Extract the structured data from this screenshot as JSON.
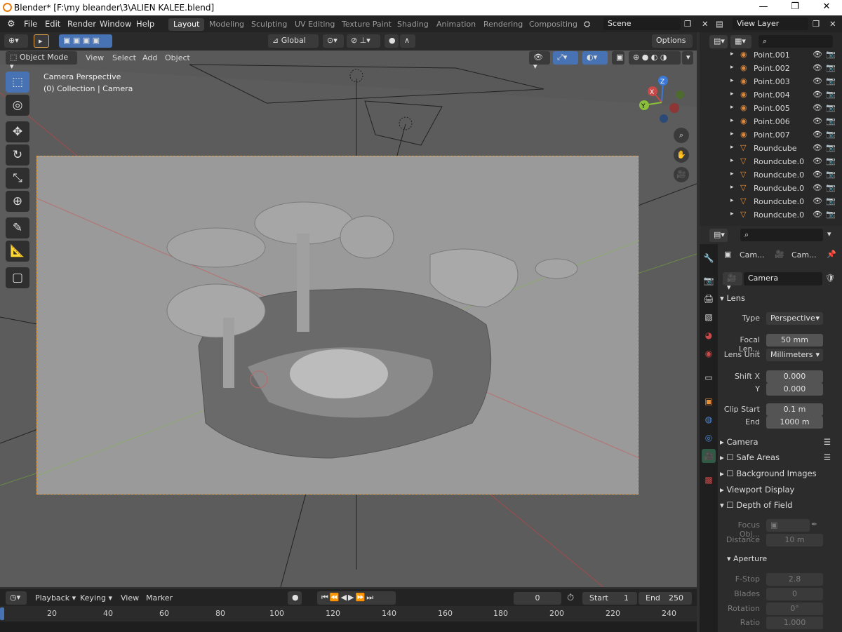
{
  "titlebar": {
    "title": "Blender* [F:\\my bleander\\3\\ALIEN KALEE.blend]",
    "min": "—",
    "max": "❐",
    "close": "✕"
  },
  "topbar": {
    "menus": [
      "File",
      "Edit",
      "Render",
      "Window",
      "Help"
    ],
    "workspaces": [
      "Layout",
      "Modeling",
      "Sculpting",
      "UV Editing",
      "Texture Paint",
      "Shading",
      "Animation",
      "Rendering",
      "Compositing"
    ],
    "active_workspace": "Layout",
    "scene": "Scene",
    "view_layer": "View Layer"
  },
  "viewport_header": {
    "transform_orientation": "Global",
    "options": "Options",
    "mode": "Object Mode",
    "menus": [
      "View",
      "Select",
      "Add",
      "Object"
    ]
  },
  "viewport": {
    "camera_label": "Camera Perspective",
    "collection_label": "(0) Collection | Camera",
    "gizmo": {
      "x": "X",
      "y": "Y",
      "z": "Z"
    }
  },
  "outliner": {
    "items": [
      {
        "name": "Point.001",
        "type": "light"
      },
      {
        "name": "Point.002",
        "type": "light"
      },
      {
        "name": "Point.003",
        "type": "light"
      },
      {
        "name": "Point.004",
        "type": "light"
      },
      {
        "name": "Point.005",
        "type": "light"
      },
      {
        "name": "Point.006",
        "type": "light"
      },
      {
        "name": "Point.007",
        "type": "light"
      },
      {
        "name": "Roundcube",
        "type": "mesh"
      },
      {
        "name": "Roundcube.0",
        "type": "mesh"
      },
      {
        "name": "Roundcube.0",
        "type": "mesh"
      },
      {
        "name": "Roundcube.0",
        "type": "mesh"
      },
      {
        "name": "Roundcube.0",
        "type": "mesh"
      },
      {
        "name": "Roundcube.0",
        "type": "mesh"
      }
    ]
  },
  "properties": {
    "breadcrumb_a": "Cam...",
    "breadcrumb_b": "Cam...",
    "datablock": "Camera",
    "lens_header": "Lens",
    "type_label": "Type",
    "type_value": "Perspective",
    "focal_label": "Focal Len...",
    "focal_value": "50 mm",
    "lens_unit_label": "Lens Unit",
    "lens_unit_value": "Millimeters",
    "shift_x_label": "Shift X",
    "shift_x_value": "0.000",
    "shift_y_label": "Y",
    "shift_y_value": "0.000",
    "clip_start_label": "Clip Start",
    "clip_start_value": "0.1 m",
    "clip_end_label": "End",
    "clip_end_value": "1000 m",
    "sections": [
      "Camera",
      "Safe Areas",
      "Background Images",
      "Viewport Display",
      "Depth of Field"
    ],
    "focus_label": "Focus Obj...",
    "distance_label": "Distance",
    "distance_value": "10 m",
    "aperture_header": "Aperture",
    "fstop_label": "F-Stop",
    "fstop_value": "2.8",
    "blades_label": "Blades",
    "blades_value": "0",
    "rotation_label": "Rotation",
    "rotation_value": "0°",
    "ratio_label": "Ratio",
    "ratio_value": "1.000"
  },
  "timeline": {
    "menus": [
      "Playback",
      "Keying",
      "View",
      "Marker"
    ],
    "current_frame": "0",
    "start_label": "Start",
    "start_value": "1",
    "end_label": "End",
    "end_value": "250",
    "ruler": [
      "20",
      "40",
      "60",
      "80",
      "100",
      "120",
      "140",
      "160",
      "180",
      "200",
      "220",
      "240"
    ]
  },
  "colors": {
    "accent": "#4772b3",
    "frame": "#e8a64f",
    "light_icon": "#e0883a",
    "mesh_icon": "#e8913b"
  }
}
